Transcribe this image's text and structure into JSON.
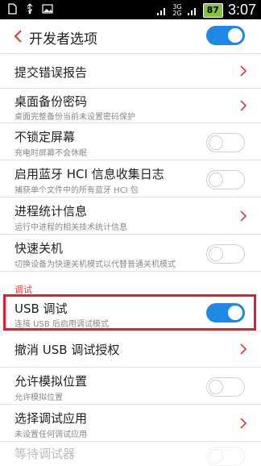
{
  "status_bar": {
    "network_top": "3G",
    "network_bottom": "2G",
    "battery": "87",
    "time": "3:07"
  },
  "header": {
    "title": "开发者选项",
    "master_toggle": "on"
  },
  "items": [
    {
      "title": "提交错误报告"
    },
    {
      "title": "桌面备份密码",
      "subtitle": "桌面完整备份当前未设置密码保护"
    },
    {
      "title": "不锁定屏幕",
      "subtitle": "充电时屏幕不会休眠",
      "toggle": "off"
    },
    {
      "title": "启用蓝牙 HCI 信息收集日志",
      "subtitle": "捕获单个文件中的所有蓝牙 HCI 包",
      "toggle": "off"
    },
    {
      "title": "进程统计信息",
      "subtitle": "运行中进程的相关技术统计信息"
    },
    {
      "title": "快速关机",
      "subtitle": "切换设备为快速关机模式以代替普通关机模式",
      "toggle": "off"
    }
  ],
  "section_debug": "调试",
  "debug_items": [
    {
      "title": "USB 调试",
      "subtitle": "连接 USB 后启用调试模式",
      "toggle": "on"
    },
    {
      "title": "撤消 USB 调试授权"
    },
    {
      "title": "允许模拟位置",
      "subtitle": "允许模拟位置",
      "toggle": "off"
    },
    {
      "title": "选择调试应用",
      "subtitle": "未设置任何调试应用"
    },
    {
      "title": "等待调试器"
    }
  ],
  "colors": {
    "accent": "#e0424a",
    "toggle_on": "#1e88e5",
    "highlight": "#e02030"
  }
}
